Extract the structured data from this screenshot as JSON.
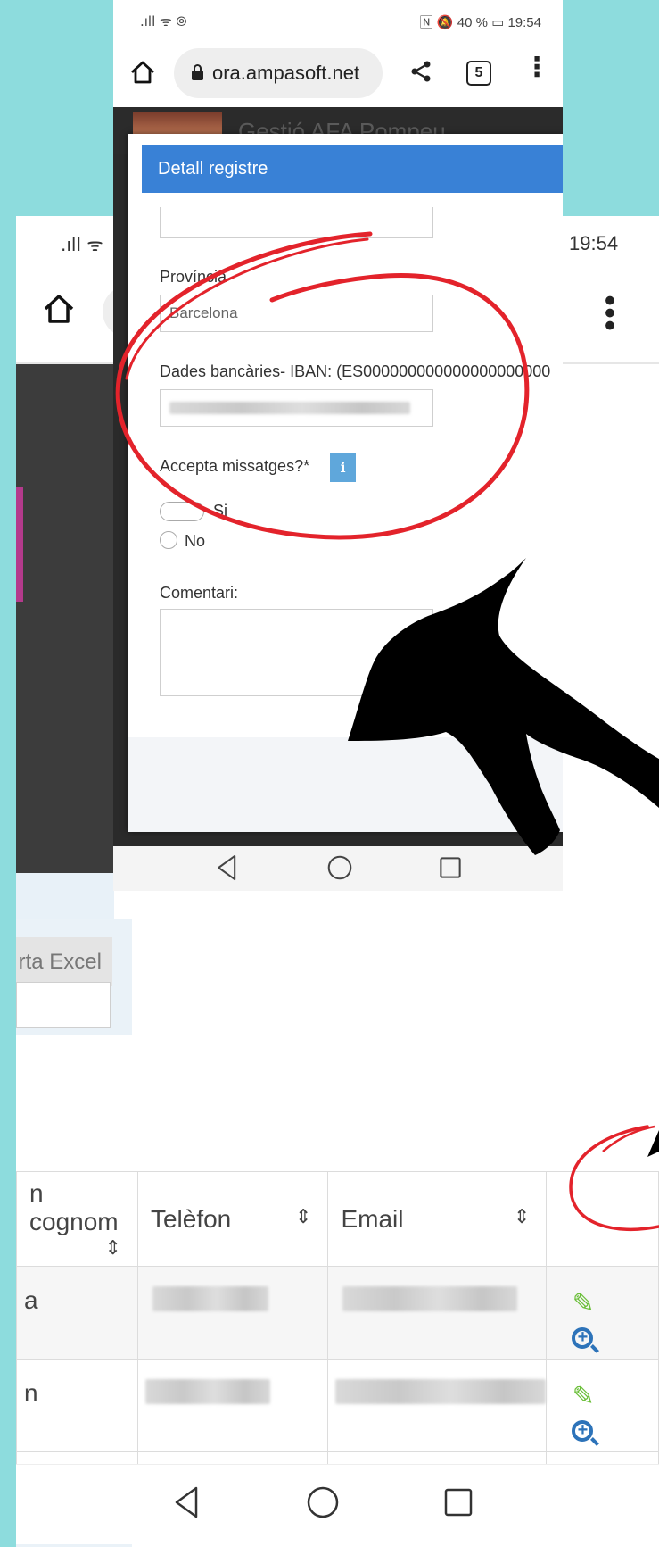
{
  "back_screen": {
    "status": {
      "signal": ".ıll ᯤ",
      "time": "19:54"
    },
    "browser": {
      "menu_label": "⋮"
    },
    "export_button_label": "rta Excel",
    "table": {
      "headers": [
        {
          "label": "n cognom",
          "sort": "⇕"
        },
        {
          "label": "Telèfon",
          "sort": "⇕"
        },
        {
          "label": "Email",
          "sort": "⇕"
        },
        {
          "label": "",
          "sort": ""
        }
      ],
      "rows": [
        {
          "name": "a"
        },
        {
          "name": "n"
        }
      ]
    }
  },
  "front_screen": {
    "status": {
      "signal": ".ıll ᯤ ⦾",
      "right": "🄽 🔕 40 % ▭ 19:54"
    },
    "browser": {
      "url": "ora.ampasoft.net",
      "tabs_count": "5",
      "share_icon": "<",
      "menu_label": "⋮"
    },
    "app_title": "Gestió AFA Pompeu",
    "modal": {
      "title": "Detall registre",
      "province_label": "Província",
      "province_value": "Barcelona",
      "iban_label": "Dades bancàries- IBAN: (ES000000000000000000000",
      "messages_label": "Accepta missatges?*",
      "info_badge": "i",
      "option_yes": "Si",
      "option_no": "No",
      "comment_label": "Comentari:"
    }
  },
  "colors": {
    "background": "#8ddcdd",
    "modal_header": "#3981d6",
    "annotation_red": "#e3232b",
    "pencil": "#6bbf3a",
    "zoom": "#2d73b9"
  }
}
